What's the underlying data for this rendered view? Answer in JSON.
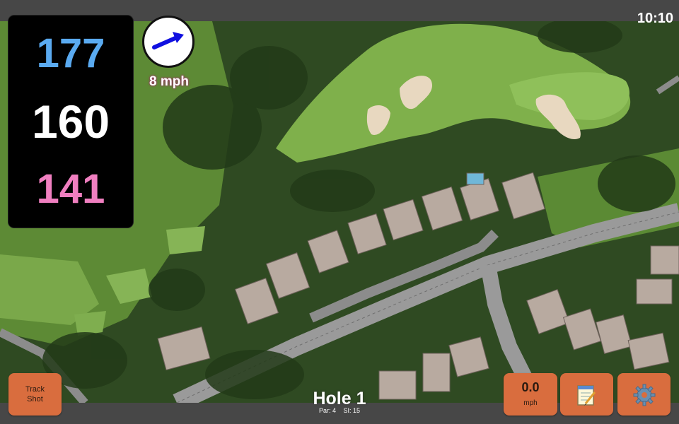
{
  "status": {
    "time": "10:10"
  },
  "distances": {
    "front": "177",
    "center": "160",
    "back": "141",
    "colors": {
      "front": "#5aaaf0",
      "center": "#ffffff",
      "back": "#f07fc0"
    }
  },
  "wind": {
    "speed_label": "8 mph",
    "direction_icon": "arrow-northeast-icon"
  },
  "hole": {
    "title": "Hole 1",
    "par_label": "Par: 4",
    "si_label": "SI: 15"
  },
  "buttons": {
    "track_shot_line1": "Track",
    "track_shot_line2": "Shot",
    "shot_distance_value": "0.0",
    "shot_distance_unit": "mph",
    "notes_icon": "notepad-icon",
    "settings_icon": "gear-icon"
  },
  "theme": {
    "button_color": "#d96d3e",
    "bar_color": "#474747",
    "panel_color": "#000000"
  }
}
